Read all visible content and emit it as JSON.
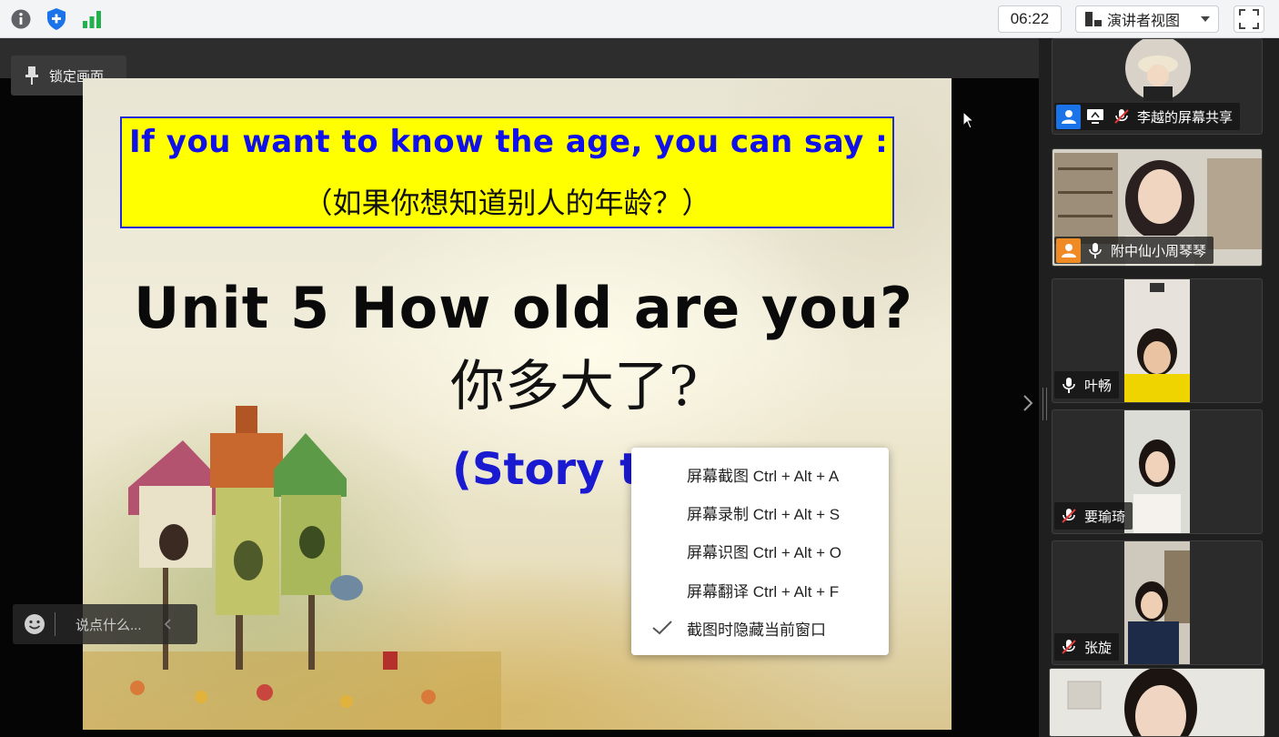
{
  "toolbar": {
    "timer": "06:22",
    "view_mode": "演讲者视图"
  },
  "stage": {
    "lock_label": "锁定画面",
    "chat_placeholder": "说点什么..."
  },
  "slide": {
    "banner_en": "If you want to know the age, you can say :",
    "banner_zh": "（如果你想知道别人的年龄？）",
    "title_en": "Unit 5  How old are you?",
    "title_zh": "你多大了?",
    "subtitle": "(Story time)"
  },
  "context_menu": {
    "items": [
      {
        "label": "屏幕截图 Ctrl + Alt + A",
        "checked": false
      },
      {
        "label": "屏幕录制 Ctrl + Alt + S",
        "checked": false
      },
      {
        "label": "屏幕识图 Ctrl + Alt + O",
        "checked": false
      },
      {
        "label": "屏幕翻译 Ctrl + Alt + F",
        "checked": false
      },
      {
        "label": "截图时隐藏当前窗口",
        "checked": true
      }
    ]
  },
  "participants": [
    {
      "name": "李越的屏幕共享",
      "mic": "muted",
      "badges": [
        "host-icon",
        "screen-share-icon"
      ]
    },
    {
      "name": "附中仙小周琴琴",
      "mic": "on",
      "badges": [
        "host-icon"
      ]
    },
    {
      "name": "叶畅",
      "mic": "on",
      "badges": []
    },
    {
      "name": "要瑜琦",
      "mic": "muted",
      "badges": []
    },
    {
      "name": "张旋",
      "mic": "muted",
      "badges": []
    }
  ],
  "colors": {
    "banner_bg": "#ffff00",
    "banner_text": "#1010e8",
    "host_badge": "#1a73e8",
    "cohost_badge": "#f08a24",
    "shield_blue": "#1a73e8",
    "signal_green": "#22b14c"
  }
}
